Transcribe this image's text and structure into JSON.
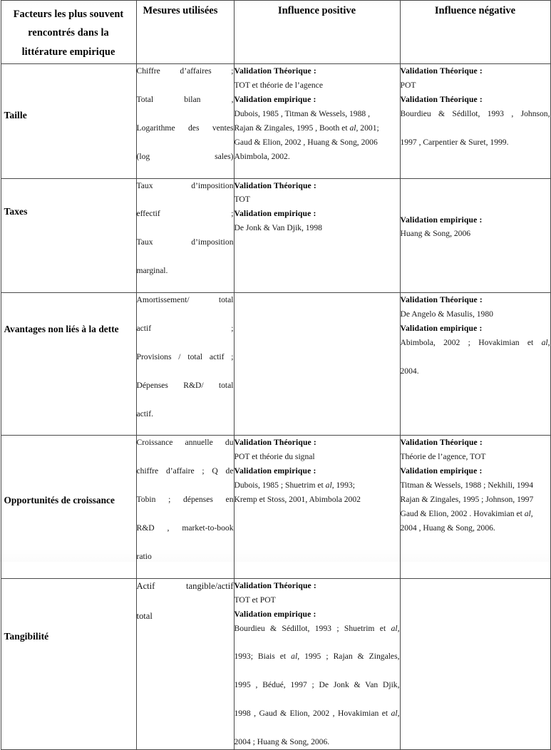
{
  "document": {
    "type": "table",
    "language": "fr",
    "title": "Facteurs les plus souvent rencontrés dans la littérature empirique"
  },
  "table": {
    "columns": [
      {
        "id": "factor",
        "label": "Facteurs les plus souvent rencontrés dans la littérature empirique",
        "label_lines": [
          "Facteurs les plus souvent",
          "rencontrés dans la",
          "littérature empirique"
        ]
      },
      {
        "id": "measure",
        "label": "Mesures utilisées"
      },
      {
        "id": "positive",
        "label": "Influence positive"
      },
      {
        "id": "negative",
        "label": "Influence négative"
      }
    ],
    "rows": [
      {
        "factor": "Taille",
        "measure_lines": [
          "Chiffre d’affaires ;",
          "Total bilan ,",
          "Logarithme des ventes",
          "(log sales)"
        ],
        "positive_lines": [
          {
            "text": "Validation Théorique :",
            "bold": true
          },
          {
            "text": "TOT et théorie de l’agence",
            "bold": false
          },
          {
            "text": "Validation empirique :",
            "bold": true
          },
          {
            "text": "Dubois, 1985 , Titman & Wessels, 1988 ,",
            "bold": false
          },
          {
            "text": "Rajan & Zingales, 1995 ,  Booth et al, 2001;",
            "bold": false
          },
          {
            "text": "Gaud & Elion, 2002 , Huang & Song, 2006",
            "bold": false
          },
          {
            "text": "Abimbola, 2002.",
            "bold": false
          }
        ],
        "negative_lines": [
          {
            "text": "Validation Théorique :",
            "bold": true
          },
          {
            "text": "POT",
            "bold": false
          },
          {
            "text": "Validation Théorique :",
            "bold": true
          },
          {
            "text": "Bourdieu & Sédillot, 1993 , Johnson,",
            "bold": false,
            "justify": true
          },
          {
            "text": "1997 , Carpentier & Suret, 1999.",
            "bold": false
          }
        ]
      },
      {
        "factor": "Taxes",
        "measure_lines": [
          "Taux d’imposition",
          "effectif ;",
          "Taux d’imposition",
          "marginal."
        ],
        "positive_lines": [
          {
            "text": "Validation Théorique :",
            "bold": true
          },
          {
            "text": "TOT",
            "bold": false
          },
          {
            "text": "Validation empirique :",
            "bold": true
          },
          {
            "text": "De Jonk & Van Djik, 1998",
            "bold": false
          }
        ],
        "negative_lines": [
          {
            "text": "Validation empirique :",
            "bold": true
          },
          {
            "text": "Huang & Song, 2006",
            "bold": false
          }
        ],
        "negative_offset_lines": 2
      },
      {
        "factor": "Avantages non liés à la dette",
        "measure_lines": [
          "Amortissement/ total",
          "actif ;",
          "Provisions / total actif ;",
          "Dépenses R&D/ total",
          "actif."
        ],
        "positive_lines": [],
        "negative_lines": [
          {
            "text": "Validation Théorique :",
            "bold": true
          },
          {
            "text": "De Angelo & Masulis, 1980",
            "bold": false
          },
          {
            "text": "Validation empirique :",
            "bold": true
          },
          {
            "text": "Abimbola, 2002 ; Hovakimian et al,",
            "bold": false,
            "justify": true
          },
          {
            "text": "2004.",
            "bold": false
          }
        ]
      },
      {
        "factor": "Opportunités de croissance",
        "measure_lines": [
          "Croissance annuelle du",
          "chiffre d’affaire ; Q de",
          "Tobin ; dépenses en",
          "R&D , market-to-book",
          "ratio"
        ],
        "positive_lines": [
          {
            "text": "Validation Théorique :",
            "bold": true
          },
          {
            "text": "POT et théorie du signal",
            "bold": false
          },
          {
            "text": "Validation empirique :",
            "bold": true
          },
          {
            "text": "Dubois, 1985 ; Shuetrim et al, 1993;",
            "bold": false
          },
          {
            "text": "Kremp et Stoss, 2001, Abimbola 2002",
            "bold": false
          }
        ],
        "negative_lines": [
          {
            "text": "Validation Théorique :",
            "bold": true
          },
          {
            "text": "Théorie de l’agence, TOT",
            "bold": false
          },
          {
            "text": "Validation empirique :",
            "bold": true
          },
          {
            "text": "Titman & Wessels, 1988 ; Nekhili, 1994",
            "bold": false
          },
          {
            "text": "Rajan & Zingales, 1995 ;  Johnson, 1997",
            "bold": false
          },
          {
            "text": "Gaud & Elion, 2002 . Hovakimian et al,",
            "bold": false
          },
          {
            "text": "2004 , Huang & Song, 2006.",
            "bold": false
          }
        ]
      },
      {
        "factor": "Tangibilité",
        "measure_lines": [
          "Actif tangible/actif",
          "total"
        ],
        "positive_lines": [
          {
            "text": "Validation Théorique :",
            "bold": true
          },
          {
            "text": "TOT et POT",
            "bold": false
          },
          {
            "text": "Validation empirique :",
            "bold": true
          },
          {
            "text": "Bourdieu & Sédillot, 1993 ; Shuetrim et al,",
            "bold": false,
            "justify": true
          },
          {
            "text": "1993; Biais et al, 1995 ; Rajan & Zingales,",
            "bold": false,
            "justify": true
          },
          {
            "text": "1995 ,  Bédué, 1997 ; De Jonk & Van Djik,",
            "bold": false,
            "justify": true
          },
          {
            "text": "1998 , Gaud & Elion, 2002 , Hovakimian et al,",
            "bold": false,
            "justify": true
          },
          {
            "text": "2004 ; Huang & Song, 2006.",
            "bold": false
          }
        ],
        "negative_lines": []
      }
    ]
  }
}
